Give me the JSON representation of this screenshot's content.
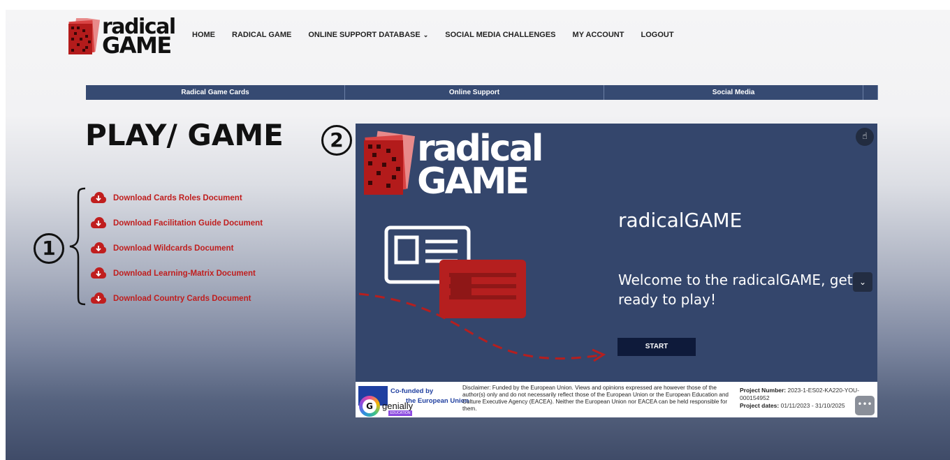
{
  "header": {
    "logo_line1": "radical",
    "logo_line2": "GAME",
    "nav": [
      {
        "label": "HOME"
      },
      {
        "label": "RADICAL GAME"
      },
      {
        "label": "ONLINE SUPPORT DATABASE"
      },
      {
        "label": "SOCIAL MEDIA CHALLENGES"
      },
      {
        "label": "MY ACCOUNT"
      },
      {
        "label": "LOGOUT"
      }
    ]
  },
  "subnav": [
    {
      "label": "Radical Game Cards"
    },
    {
      "label": "Online Support"
    },
    {
      "label": "Social Media"
    }
  ],
  "page_title": "PLAY/ GAME",
  "annotations": {
    "one": "1",
    "two": "2"
  },
  "downloads": [
    {
      "label": "Download Cards Roles Document"
    },
    {
      "label": "Download Facilitation Guide Document"
    },
    {
      "label": "Download Wildcards Document"
    },
    {
      "label": "Download Learning-Matrix Document"
    },
    {
      "label": "Download Country Cards Document"
    }
  ],
  "panel": {
    "logo_line1": "radical",
    "logo_line2": "GAME",
    "title": "radicalGAME",
    "subtitle": "Welcome to the radicalGAME, get ready to play!",
    "start_label": "START"
  },
  "footer": {
    "cofunded_line1": "Co-funded by",
    "cofunded_line2": "the European Union",
    "genially": "genially",
    "edu_badge": "EDUCATION",
    "disclaimer": "Disclaimer: Funded by the European Union. Views and opinions expressed are however those of the author(s) only and do not necessarily reflect those of the European Union or the European Education and Culture Executive Agency (EACEA). Neither the European Union nor EACEA can be held responsible for them.",
    "project_number_label": "Project Number:",
    "project_number_value": "2023-1-ES02-KA220-YOU-000154952",
    "project_dates_label": "Project dates:",
    "project_dates_value": "01/11/2023 - 31/10/2025"
  },
  "colors": {
    "accent_red": "#c01e1e",
    "panel_navy": "#34466c",
    "subnav_navy": "#364a72",
    "card_red": "#b51f1f"
  }
}
